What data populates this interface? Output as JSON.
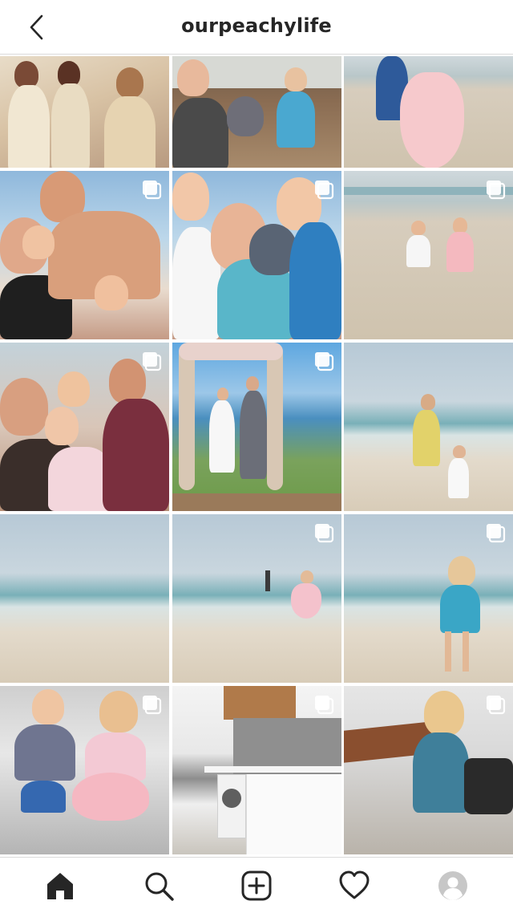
{
  "header": {
    "title": "ourpeachylife",
    "back_icon": "chevron-left-icon"
  },
  "grid": {
    "tiles": [
      {
        "scene": "people1",
        "multi": false
      },
      {
        "scene": "indoor",
        "multi": false
      },
      {
        "scene": "sand",
        "multi": false
      },
      {
        "scene": "sky",
        "multi": true
      },
      {
        "scene": "sky",
        "multi": true
      },
      {
        "scene": "sand",
        "multi": true
      },
      {
        "scene": "people2",
        "multi": true
      },
      {
        "scene": "wedding",
        "multi": true
      },
      {
        "scene": "beach",
        "multi": false
      },
      {
        "scene": "beach",
        "multi": false
      },
      {
        "scene": "beach",
        "multi": true
      },
      {
        "scene": "beach",
        "multi": true
      },
      {
        "scene": "people2",
        "multi": true
      },
      {
        "scene": "kitchen",
        "multi": true
      },
      {
        "scene": "indoor",
        "multi": true
      }
    ]
  },
  "bottom_nav": {
    "items": [
      "home-icon",
      "search-icon",
      "new-post-icon",
      "activity-heart-icon",
      "profile-avatar-icon"
    ]
  },
  "colors": {
    "text": "#262626",
    "border": "#dbdbdb",
    "icon": "#262626",
    "avatar": "#c7c7c7"
  }
}
